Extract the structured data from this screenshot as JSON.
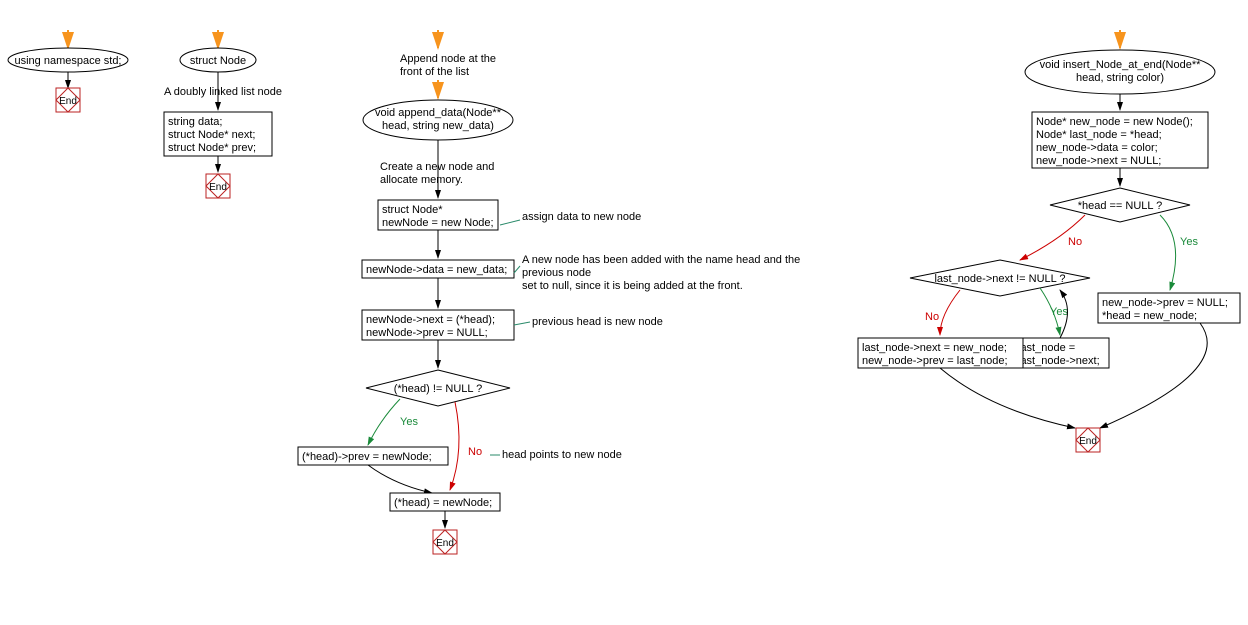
{
  "fc1": {
    "node1": "using namespace std;",
    "end": "End"
  },
  "fc2": {
    "node1": "struct Node",
    "comment1": "A doubly linked list node",
    "body1": "string data;",
    "body2": "struct Node* next;",
    "body3": "struct Node* prev;",
    "end": "End"
  },
  "fc3": {
    "comment1": "Append node at the\nfront of the list",
    "node1": "void append_data(Node**\nhead, string new_data)",
    "comment2": "Create a new node and\nallocate memory.",
    "box1a": "struct Node*",
    "box1b": "newNode = new Node;",
    "comment3": "assign data to new node",
    "box2": "newNode->data = new_data;",
    "comment4": "A new node has been added with the name head and the\nprevious node\nset to null, since it is being added at the front.",
    "box3a": "newNode->next = (*head);",
    "box3b": "newNode->prev = NULL;",
    "comment5": "previous head is new node",
    "cond1": "(*head) != NULL ?",
    "yes": "Yes",
    "no": "No",
    "box4": "(*head)->prev = newNode;",
    "comment6": "head points to new node",
    "box5": "(*head) = newNode;",
    "end": "End"
  },
  "fc4": {
    "node1": "void insert_Node_at_end(Node**\nhead, string color)",
    "box1a": "Node* new_node = new Node();",
    "box1b": "Node* last_node = *head;",
    "box1c": "new_node->data = color;",
    "box1d": "new_node->next = NULL;",
    "cond1": "*head == NULL ?",
    "yes": "Yes",
    "no": "No",
    "cond2": "last_node->next != NULL ?",
    "box2a": "new_node->prev = NULL;",
    "box2b": "*head = new_node;",
    "box3a": "last_node =",
    "box3b": "last_node->next;",
    "box4a": "last_node->next = new_node;",
    "box4b": "new_node->prev = last_node;",
    "end": "End"
  }
}
